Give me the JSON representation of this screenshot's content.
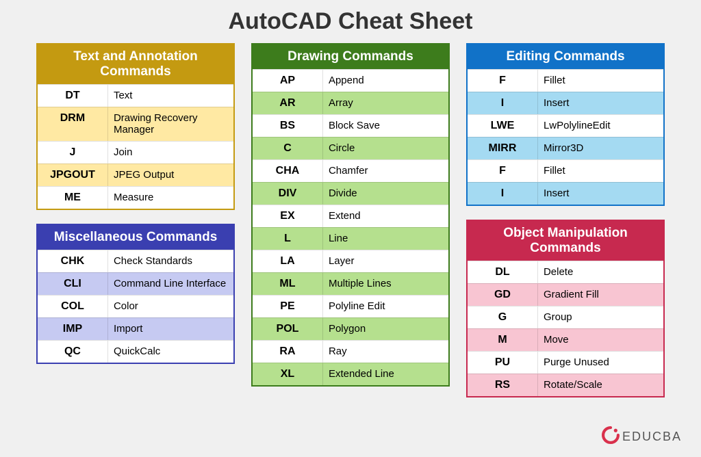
{
  "title": "AutoCAD Cheat Sheet",
  "sections": {
    "text_annotation": {
      "title": "Text and Annotation Commands",
      "rows": [
        {
          "cmd": "DT",
          "desc": "Text"
        },
        {
          "cmd": "DRM",
          "desc": "Drawing Recovery Manager"
        },
        {
          "cmd": "J",
          "desc": "Join"
        },
        {
          "cmd": "JPGOUT",
          "desc": "JPEG Output"
        },
        {
          "cmd": "ME",
          "desc": "Measure"
        }
      ]
    },
    "misc": {
      "title": "Miscellaneous Commands",
      "rows": [
        {
          "cmd": "CHK",
          "desc": "Check Standards"
        },
        {
          "cmd": "CLI",
          "desc": "Command Line Interface"
        },
        {
          "cmd": "COL",
          "desc": "Color"
        },
        {
          "cmd": "IMP",
          "desc": "Import"
        },
        {
          "cmd": "QC",
          "desc": "QuickCalc"
        }
      ]
    },
    "drawing": {
      "title": "Drawing Commands",
      "rows": [
        {
          "cmd": "AP",
          "desc": "Append"
        },
        {
          "cmd": "AR",
          "desc": "Array"
        },
        {
          "cmd": "BS",
          "desc": "Block Save"
        },
        {
          "cmd": "C",
          "desc": "Circle"
        },
        {
          "cmd": "CHA",
          "desc": "Chamfer"
        },
        {
          "cmd": "DIV",
          "desc": "Divide"
        },
        {
          "cmd": "EX",
          "desc": "Extend"
        },
        {
          "cmd": "L",
          "desc": "Line"
        },
        {
          "cmd": "LA",
          "desc": "Layer"
        },
        {
          "cmd": "ML",
          "desc": "Multiple Lines"
        },
        {
          "cmd": "PE",
          "desc": "Polyline Edit"
        },
        {
          "cmd": "POL",
          "desc": "Polygon"
        },
        {
          "cmd": "RA",
          "desc": "Ray"
        },
        {
          "cmd": "XL",
          "desc": "Extended Line"
        }
      ]
    },
    "editing": {
      "title": "Editing Commands",
      "rows": [
        {
          "cmd": "F",
          "desc": "Fillet"
        },
        {
          "cmd": "I",
          "desc": "Insert"
        },
        {
          "cmd": "LWE",
          "desc": "LwPolylineEdit"
        },
        {
          "cmd": "MIRR",
          "desc": "Mirror3D"
        },
        {
          "cmd": "F",
          "desc": "Fillet"
        },
        {
          "cmd": "I",
          "desc": "Insert"
        }
      ]
    },
    "object_manip": {
      "title": "Object Manipulation Commands",
      "rows": [
        {
          "cmd": "DL",
          "desc": "Delete"
        },
        {
          "cmd": "GD",
          "desc": "Gradient Fill"
        },
        {
          "cmd": "G",
          "desc": "Group"
        },
        {
          "cmd": "M",
          "desc": "Move"
        },
        {
          "cmd": "PU",
          "desc": "Purge Unused"
        },
        {
          "cmd": "RS",
          "desc": "Rotate/Scale"
        }
      ]
    }
  },
  "logo_text": "EDUCBA"
}
